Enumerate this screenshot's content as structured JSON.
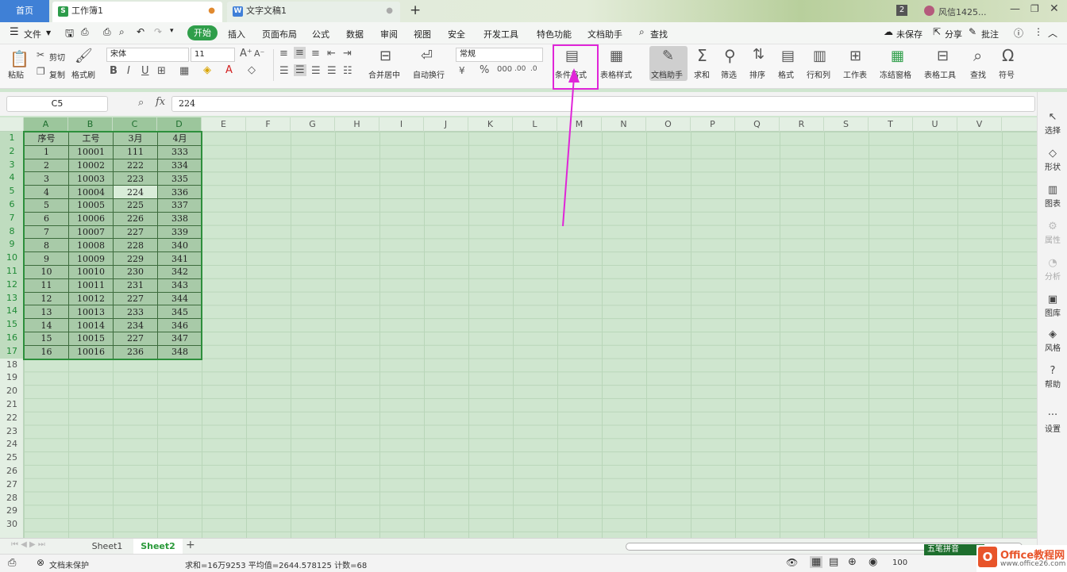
{
  "titlebar": {
    "home": "首页",
    "doc_tab": "工作簿1",
    "doc_tab2": "文字文稿1",
    "add": "+",
    "badge": "2",
    "user": "风信1425..."
  },
  "menu": {
    "file": "文件",
    "items": [
      "开始",
      "插入",
      "页面布局",
      "公式",
      "数据",
      "审阅",
      "视图",
      "安全",
      "开发工具",
      "特色功能",
      "文档助手",
      "查找"
    ],
    "unsaved": "未保存",
    "share": "分享",
    "annotate": "批注"
  },
  "ribbon": {
    "paste": "粘贴",
    "cut": "剪切",
    "copy": "复制",
    "format_painter": "格式刷",
    "font_name": "宋体",
    "font_size": "11",
    "merge_center": "合并居中",
    "auto_wrap": "自动换行",
    "number_format": "常规",
    "conditional_format": "条件格式",
    "table_style": "表格样式",
    "doc_assistant": "文档助手",
    "sum": "求和",
    "filter": "筛选",
    "sort": "排序",
    "format": "格式",
    "row_col": "行和列",
    "worksheet": "工作表",
    "freeze": "冻结窗格",
    "table_tools": "表格工具",
    "find": "查找",
    "symbol": "符号"
  },
  "formula": {
    "cell_ref": "C5",
    "fx": "fx",
    "value": "224"
  },
  "grid": {
    "columns": [
      "A",
      "B",
      "C",
      "D",
      "E",
      "F",
      "G",
      "H",
      "I",
      "J",
      "K",
      "L",
      "M",
      "N",
      "O",
      "P",
      "Q",
      "R",
      "S",
      "T",
      "U",
      "V"
    ],
    "rows": [
      "1",
      "2",
      "3",
      "4",
      "5",
      "6",
      "7",
      "8",
      "9",
      "10",
      "11",
      "12",
      "13",
      "14",
      "15",
      "16",
      "17",
      "18",
      "19",
      "20",
      "21",
      "22",
      "23",
      "24",
      "25",
      "26",
      "27",
      "28",
      "29",
      "30"
    ],
    "table": [
      [
        "序号",
        "工号",
        "3月",
        "4月"
      ],
      [
        "1",
        "10001",
        "111",
        "333"
      ],
      [
        "2",
        "10002",
        "222",
        "334"
      ],
      [
        "3",
        "10003",
        "223",
        "335"
      ],
      [
        "4",
        "10004",
        "224",
        "336"
      ],
      [
        "5",
        "10005",
        "225",
        "337"
      ],
      [
        "6",
        "10006",
        "226",
        "338"
      ],
      [
        "7",
        "10007",
        "227",
        "339"
      ],
      [
        "8",
        "10008",
        "228",
        "340"
      ],
      [
        "9",
        "10009",
        "229",
        "341"
      ],
      [
        "10",
        "10010",
        "230",
        "342"
      ],
      [
        "11",
        "10011",
        "231",
        "343"
      ],
      [
        "12",
        "10012",
        "227",
        "344"
      ],
      [
        "13",
        "10013",
        "233",
        "345"
      ],
      [
        "14",
        "10014",
        "234",
        "346"
      ],
      [
        "15",
        "10015",
        "227",
        "347"
      ],
      [
        "16",
        "10016",
        "236",
        "348"
      ]
    ]
  },
  "right_panel": [
    "选择",
    "形状",
    "图表",
    "属性",
    "分析",
    "图库",
    "风格",
    "帮助",
    "设置"
  ],
  "sheets": [
    "Sheet1",
    "Sheet2"
  ],
  "status": {
    "protect": "文档未保护",
    "stats": "求和=16万9253  平均值=2644.578125  计数=68",
    "zoom": "100"
  },
  "ime": "五笔拼音",
  "logo": {
    "name": "Office教程网",
    "url": "www.office26.com"
  },
  "colors": {
    "accent_green": "#2f9e4a",
    "highlight": "#e025d8",
    "home_tab": "#3f80d6"
  }
}
